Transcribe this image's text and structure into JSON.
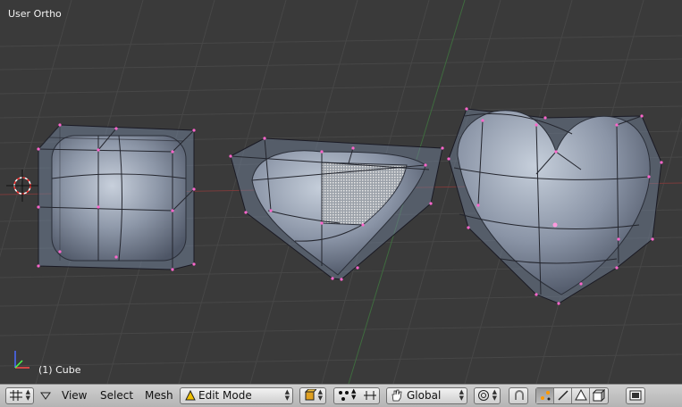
{
  "viewport": {
    "view_label": "User Ortho",
    "object_label": "(1) Cube",
    "objects": [
      "cube",
      "heart-partial-selection",
      "heart"
    ]
  },
  "header": {
    "menus": [
      "View",
      "Select",
      "Mesh"
    ],
    "mode_label": "Edit Mode",
    "orientation_label": "Global",
    "icons": [
      "viewport-type-icon",
      "collapse-triangle-icon",
      "draw-type-icon",
      "pivot-point-icon",
      "manipulator-icon",
      "hand-icon",
      "proportional-edit-icon",
      "snap-icon",
      "vertex-select-icon",
      "edge-select-icon",
      "face-select-icon",
      "occlude-geometry-icon",
      "render-icon"
    ]
  },
  "colors": {
    "viewport_bg": "#3a3a3a",
    "grid_line": "#464646",
    "x_axis": "#7a3a3a",
    "y_axis": "#3f6b3f",
    "mesh_fill": "#7f8a9c",
    "cage_edge": "#1a1a24",
    "vertex": "#ff66cc",
    "header_bg": "#c0c0c0"
  }
}
